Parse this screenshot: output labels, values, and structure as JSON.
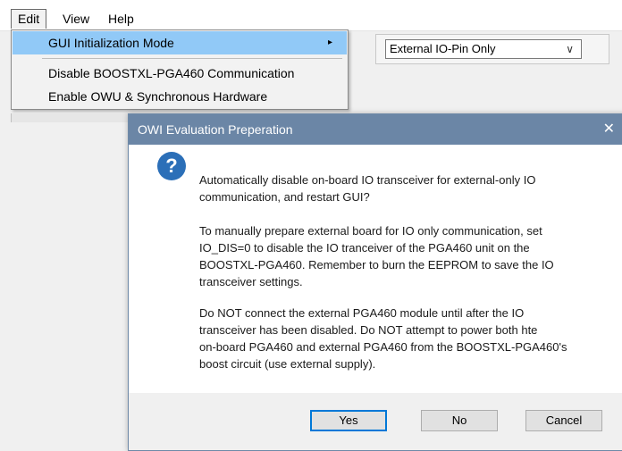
{
  "menubar": {
    "items": [
      "Edit",
      "View",
      "Help"
    ]
  },
  "edit_menu": {
    "items": [
      {
        "label": "GUI Initialization Mode"
      },
      {
        "label": "Disable BOOSTXL-PGA460 Communication"
      },
      {
        "label": "Enable OWU & Synchronous Hardware"
      }
    ],
    "arrow": "▸"
  },
  "mode_select": {
    "value": "External IO-Pin Only",
    "chevron": "∨"
  },
  "dialog": {
    "title": "OWI Evaluation Preperation",
    "close": "✕",
    "icon_glyph": "?",
    "paragraphs": [
      "Automatically disable on-board IO transceiver for external-only IO\ncommunication, and restart GUI?",
      "To manually prepare external board for IO only communication, set\nIO_DIS=0 to disable the IO tranceiver of the PGA460 unit on the\nBOOSTXL-PGA460. Remember to burn the EEPROM to save the IO\ntransceiver settings.",
      "Do NOT connect the external PGA460 module until after the IO\ntransceiver has been disabled. Do NOT attempt to power both hte\non-board PGA460 and external PGA460 from the BOOSTXL-PGA460's\nboost circuit (use external supply)."
    ],
    "buttons": {
      "yes": "Yes",
      "no": "No",
      "cancel": "Cancel"
    }
  },
  "colors": {
    "title_bar": "#6b86a6",
    "highlight": "#91c9f7",
    "question_icon": "#2b6fb8",
    "default_button_border": "#0078d7"
  }
}
